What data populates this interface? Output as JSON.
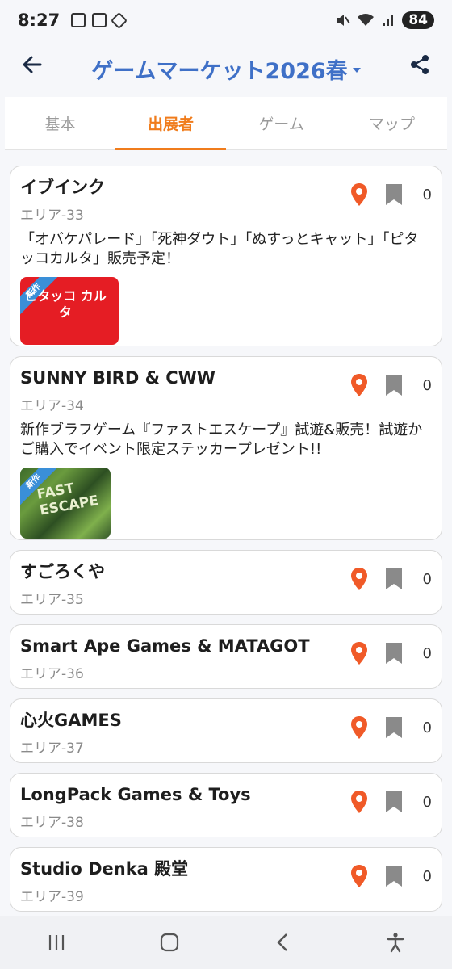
{
  "status": {
    "time": "8:27",
    "battery": "84"
  },
  "header": {
    "title": "ゲームマーケット2026春"
  },
  "tabs": [
    {
      "label": "基本",
      "active": false
    },
    {
      "label": "出展者",
      "active": true
    },
    {
      "label": "ゲーム",
      "active": false
    },
    {
      "label": "マップ",
      "active": false
    }
  ],
  "exhibitors": [
    {
      "name": "イブインク",
      "area": "エリア-33",
      "description": "「オバケパレード」「死神ダウト」「ぬすっとキャット」「ピタッコカルタ」販売予定！",
      "bookmarks": "0",
      "thumb_logo": "ピタッコ カルタ",
      "new_badge": "新作"
    },
    {
      "name": "SUNNY BIRD & CWW",
      "area": "エリア-34",
      "description": "新作ブラフゲーム『ファストエスケープ』試遊&販売！試遊かご購入でイベント限定ステッカープレゼント!!",
      "bookmarks": "0",
      "thumb_logo": "FAST ESCAPE",
      "new_badge": "新作"
    },
    {
      "name": "すごろくや",
      "area": "エリア-35",
      "bookmarks": "0"
    },
    {
      "name": "Smart Ape Games & MATAGOT",
      "area": "エリア-36",
      "bookmarks": "0"
    },
    {
      "name": "心火GAMES",
      "area": "エリア-37",
      "bookmarks": "0"
    },
    {
      "name": "LongPack Games & Toys",
      "area": "エリア-38",
      "bookmarks": "0"
    },
    {
      "name": "Studio Denka 殿堂",
      "area": "エリア-39",
      "bookmarks": "0"
    }
  ],
  "colors": {
    "accent": "#f07c1c",
    "title": "#3f70c7",
    "pin": "#f05a28",
    "bookmark": "#8a8a8a"
  }
}
